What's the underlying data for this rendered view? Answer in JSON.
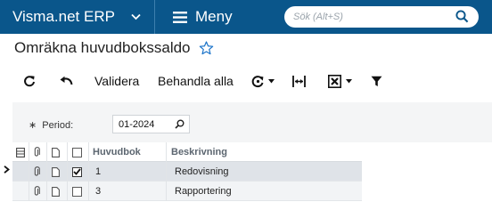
{
  "app": {
    "brand": "Visma.net ERP",
    "menu_label": "Meny"
  },
  "search": {
    "placeholder": "Sök (Alt+S)"
  },
  "page": {
    "title": "Omräkna huvudbokssaldo"
  },
  "toolbar": {
    "refresh_icon": "refresh-icon",
    "undo_icon": "undo-icon",
    "validate_label": "Validera",
    "process_all_label": "Behandla alla"
  },
  "filter": {
    "period_label": "Period:",
    "period_required_mark": "∗",
    "period_value": "01-2024"
  },
  "grid": {
    "columns": {
      "ledger": "Huvudbok",
      "description": "Beskrivning"
    },
    "rows": [
      {
        "ledger": "1",
        "description": "Redovisning",
        "selected": true,
        "checked": true
      },
      {
        "ledger": "3",
        "description": "Rapportering",
        "selected": false,
        "checked": false
      }
    ]
  },
  "colors": {
    "topbar": "#0a568b",
    "accent": "#1a73c9",
    "selected_row": "#dfe3e8"
  }
}
